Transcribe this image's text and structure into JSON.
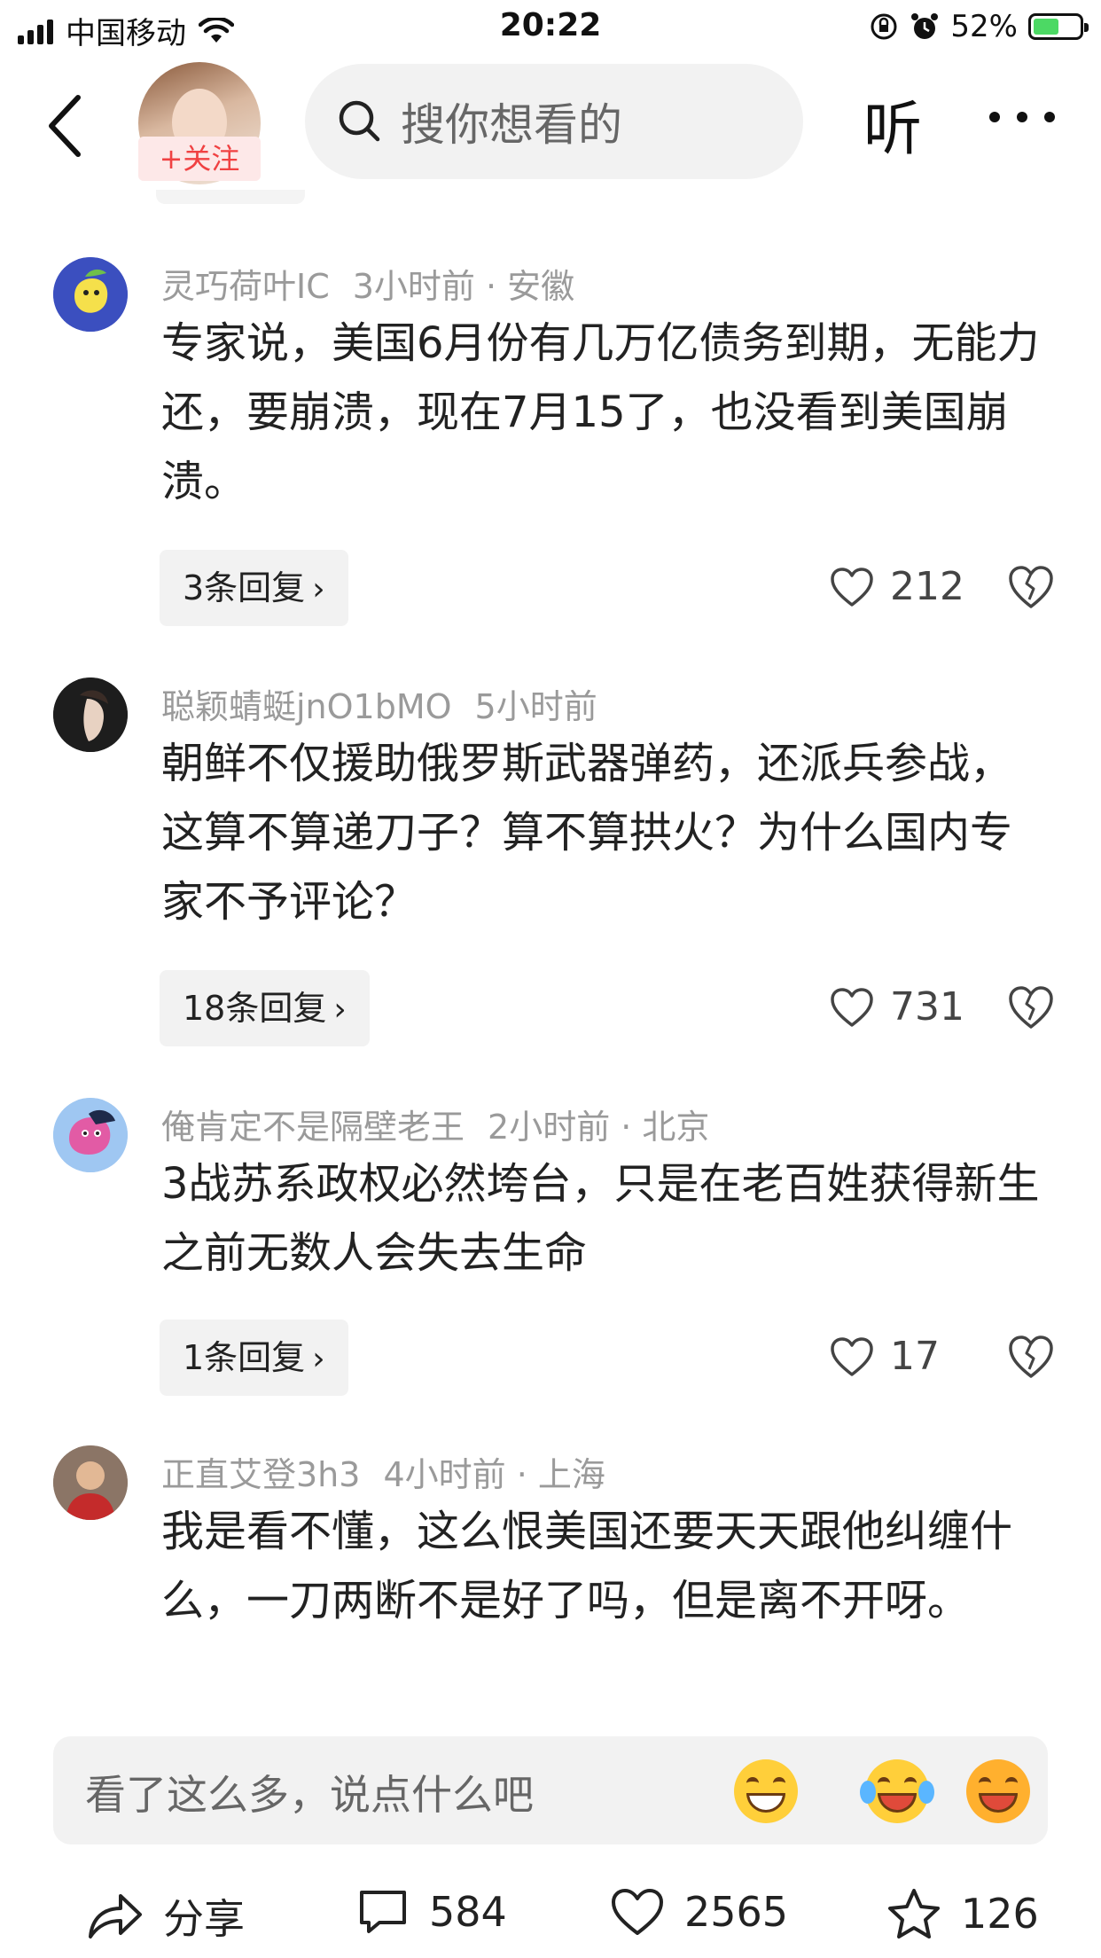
{
  "status_bar": {
    "carrier": "中国移动",
    "time": "20:22",
    "battery": "52%"
  },
  "header": {
    "follow_label": "+关注",
    "search_placeholder": "搜你想看的",
    "listen_label": "听"
  },
  "comments": [
    {
      "username": "灵巧荷叶IC",
      "time_location": "3小时前 · 安徽",
      "text": "专家说，美国6月份有几万亿债务到期，无能力还，要崩溃，现在7月15了，也没看到美国崩溃。",
      "replies": "3条回复",
      "likes": "212"
    },
    {
      "username": "聪颖蜻蜓jnO1bMO",
      "time_location": "5小时前",
      "text": "朝鲜不仅援助俄罗斯武器弹药，还派兵参战，这算不算递刀子？算不算拱火？为什么国内专家不予评论？",
      "replies": "18条回复",
      "likes": "731"
    },
    {
      "username": "俺肯定不是隔壁老王",
      "time_location": "2小时前 · 北京",
      "text": "3战苏系政权必然垮台，只是在老百姓获得新生之前无数人会失去生命",
      "replies": "1条回复",
      "likes": "17"
    },
    {
      "username": "正直艾登3h3",
      "time_location": "4小时前 · 上海",
      "text": "我是看不懂，这么恨美国还要天天跟他纠缠什么，一刀两断不是好了吗，但是离不开呀。"
    }
  ],
  "comment_input": {
    "placeholder": "看了这么多，说点什么吧"
  },
  "bottom_bar": {
    "share_label": "分享",
    "comment_count": "584",
    "like_count": "2565",
    "favorite_count": "126"
  },
  "colors": {
    "accent": "#f04142",
    "meta_text": "#9a9a9a",
    "input_bg": "#f2f2f2",
    "battery_green": "#4cd964"
  }
}
